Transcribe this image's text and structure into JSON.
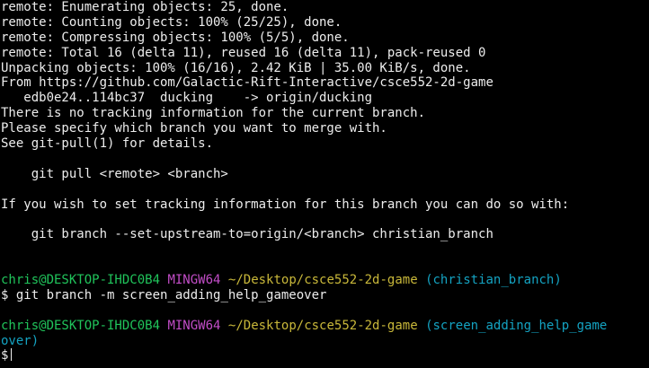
{
  "terminal": {
    "output": [
      "remote: Enumerating objects: 25, done.",
      "remote: Counting objects: 100% (25/25), done.",
      "remote: Compressing objects: 100% (5/5), done.",
      "remote: Total 16 (delta 11), reused 16 (delta 11), pack-reused 0",
      "Unpacking objects: 100% (16/16), 2.42 KiB | 35.00 KiB/s, done.",
      "From https://github.com/Galactic-Rift-Interactive/csce552-2d-game",
      "   edb0e24..114bc37  ducking    -> origin/ducking",
      "There is no tracking information for the current branch.",
      "Please specify which branch you want to merge with.",
      "See git-pull(1) for details.",
      "",
      "    git pull <remote> <branch>",
      "",
      "If you wish to set tracking information for this branch you can do so with:",
      "",
      "    git branch --set-upstream-to=origin/<branch> christian_branch",
      "",
      ""
    ],
    "prompt1": {
      "user_host": "chris@DESKTOP-IHDC0B4",
      "shell": "MINGW64",
      "path": "~/Desktop/csce552-2d-game",
      "branch": "(christian_branch)",
      "symbol": "$",
      "command": "git branch -m screen_adding_help_gameover"
    },
    "prompt2": {
      "user_host": "chris@DESKTOP-IHDC0B4",
      "shell": "MINGW64",
      "path": "~/Desktop/csce552-2d-game",
      "branch_part1": "(screen_adding_help_game",
      "branch_part2": "over)",
      "symbol": "$",
      "command": ""
    },
    "colors": {
      "background": "#000000",
      "text": "#ededed",
      "user_host": "#20c45b",
      "shell": "#c24dc7",
      "path": "#c9b83a",
      "branch": "#14a3c2"
    }
  }
}
